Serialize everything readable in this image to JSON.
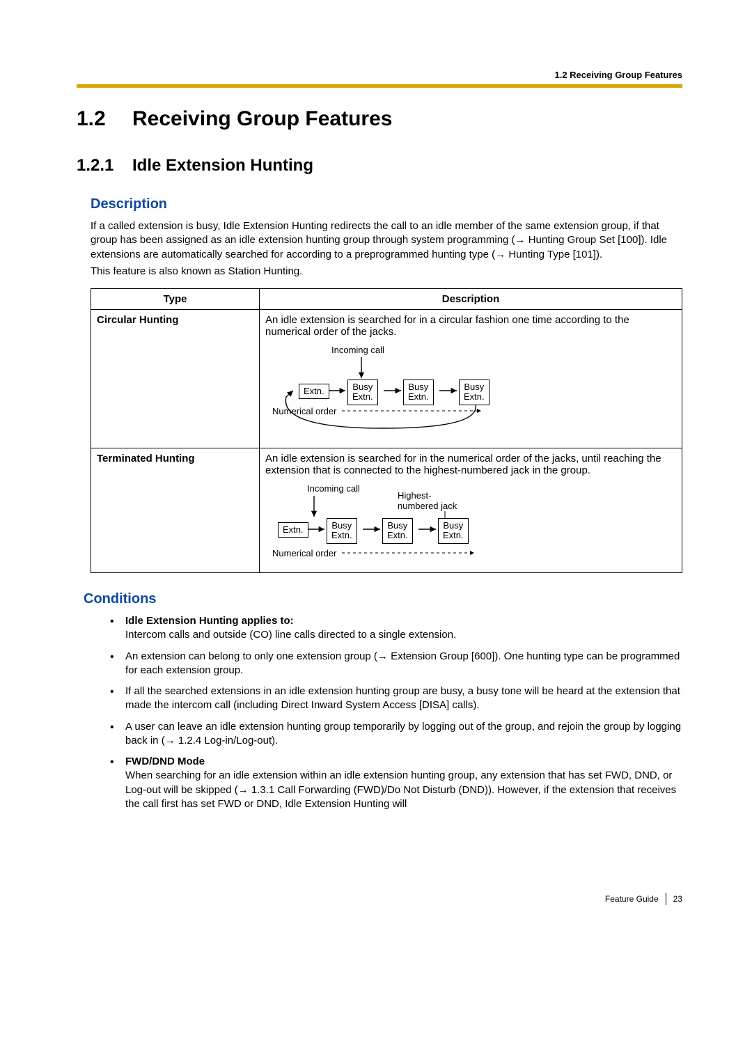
{
  "runningHead": "1.2 Receiving Group Features",
  "h1": {
    "num": "1.2",
    "title": "Receiving Group Features"
  },
  "h2": {
    "num": "1.2.1",
    "title": "Idle Extension Hunting"
  },
  "descHeading": "Description",
  "descP1a": "If a called extension is busy, Idle Extension Hunting redirects the call to an idle member of the same extension group, if that group has been assigned as an idle extension hunting group through system programming (",
  "descP1b": " Hunting Group Set [100]). Idle extensions are automatically searched for according to a preprogrammed hunting type (",
  "descP1c": " Hunting Type [101]).",
  "descP2": "This feature is also known as Station Hunting.",
  "table": {
    "headType": "Type",
    "headDesc": "Description",
    "row1": {
      "type": "Circular Hunting",
      "desc": "An idle extension is searched for in a circular fashion one time according to the numerical order of the jacks."
    },
    "row2": {
      "type": "Terminated Hunting",
      "desc": "An idle extension is searched for in the numerical order of the jacks, until reaching the extension that is connected to the highest-numbered jack in the group."
    }
  },
  "diag": {
    "incoming": "Incoming call",
    "extn": "Extn.",
    "busyExtn": "Busy\nExtn.",
    "numOrder": "Numerical order",
    "highestJack": "Highest-\nnumbered jack"
  },
  "condHeading": "Conditions",
  "cond1": {
    "title": "Idle Extension Hunting applies to:",
    "text": "Intercom calls and outside (CO) line calls directed to a single extension."
  },
  "cond2a": "An extension can belong to only one extension group (",
  "cond2b": " Extension Group [600]). One hunting type can be programmed for each extension group.",
  "cond3": "If all the searched extensions in an idle extension hunting group are busy, a busy tone will be heard at the extension that made the intercom call (including Direct Inward System Access [DISA] calls).",
  "cond4a": "A user can leave an idle extension hunting group temporarily by logging out of the group, and rejoin the group by logging back in (",
  "cond4b": " 1.2.4 Log-in/Log-out).",
  "cond5": {
    "title": "FWD/DND Mode",
    "text1": "When searching for an idle extension within an idle extension hunting group, any extension that has set FWD, DND, or Log-out will be skipped (",
    "text2": " 1.3.1 Call Forwarding (FWD)/Do Not Disturb (DND)). However, if the extension that receives the call first has set FWD or DND, Idle Extension Hunting will"
  },
  "arrow": "→",
  "footer": {
    "guide": "Feature Guide",
    "page": "23"
  }
}
